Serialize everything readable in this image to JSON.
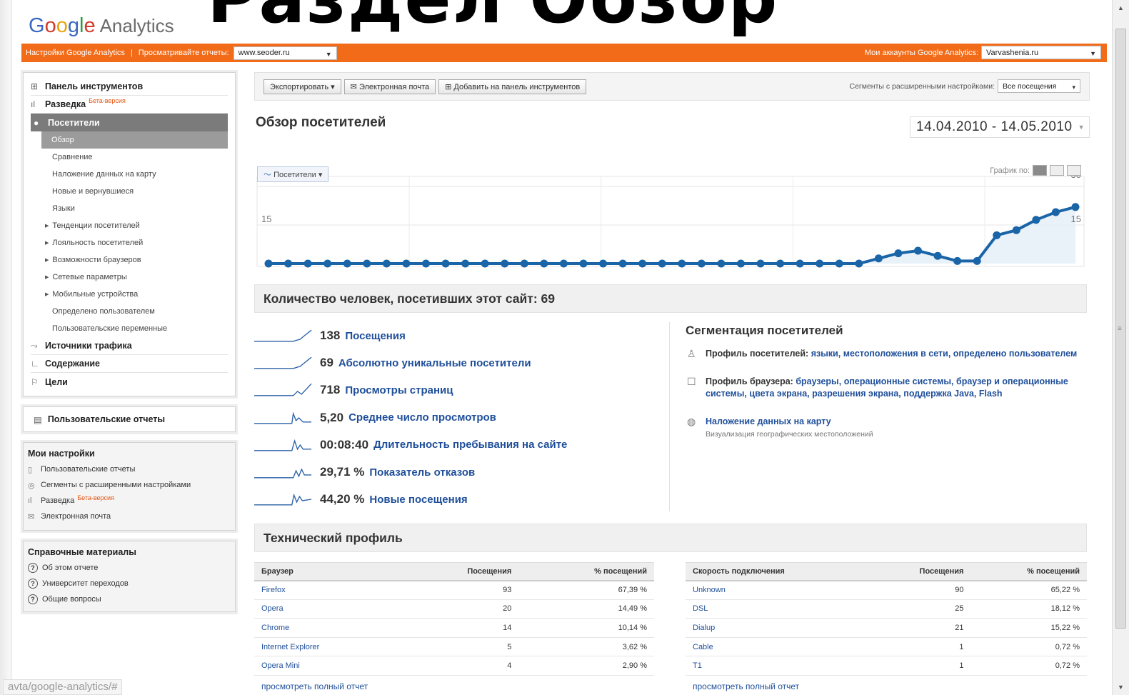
{
  "overlay": {
    "title": "Раздел Обзор"
  },
  "logo": {
    "g1": "G",
    "o1": "o",
    "o2": "o",
    "g2": "g",
    "l": "l",
    "e": "e",
    "analytics": "Analytics"
  },
  "topbar": {
    "settings_link": "Настройки Google Analytics",
    "sep": "|",
    "view_label": "Просматривайте отчеты:",
    "site_value": "www.seoder.ru",
    "accounts_label": "Мои аккаунты Google Analytics:",
    "account_value": "Varvashenia.ru"
  },
  "sidebar": {
    "top_items": [
      {
        "label": "Панель инструментов"
      },
      {
        "label": "Разведка",
        "badge": "Бета-версия"
      },
      {
        "label": "Посетители"
      }
    ],
    "visitors_sub": [
      "Обзор",
      "Сравнение",
      "Наложение данных на карту",
      "Новые и вернувшиеся",
      "Языки",
      "Тенденции посетителей",
      "Лояльность посетителей",
      "Возможности браузеров",
      "Сетевые параметры",
      "Мобильные устройства",
      "Определено пользователем",
      "Пользовательские переменные"
    ],
    "bottom_items": [
      {
        "label": "Источники трафика"
      },
      {
        "label": "Содержание"
      },
      {
        "label": "Цели"
      }
    ],
    "custom_reports": "Пользовательские отчеты",
    "my_settings": {
      "title": "Мои настройки",
      "items": [
        "Пользовательские отчеты",
        "Сегменты с расширенными настройками",
        "Разведка",
        "Электронная почта"
      ],
      "badge": "Бета-версия"
    },
    "help": {
      "title": "Справочные материалы",
      "items": [
        "Об этом отчете",
        "Университет переходов",
        "Общие вопросы"
      ]
    }
  },
  "toolbar": {
    "export": "Экспортировать",
    "email": "Электронная почта",
    "add_dashboard": "Добавить на панель инструментов",
    "segments_label": "Сегменты с расширенными настройками:",
    "segments_value": "Все посещения"
  },
  "page": {
    "title": "Обзор посетителей",
    "date_range": "14.04.2010 - 14.05.2010"
  },
  "chart": {
    "metric_selector": "Посетители",
    "graph_by_label": "График по:"
  },
  "chart_data": {
    "type": "line",
    "series": [
      {
        "name": "Посетители",
        "values": [
          0,
          0,
          0,
          0,
          0,
          0,
          0,
          0,
          0,
          0,
          0,
          0,
          0,
          0,
          0,
          0,
          0,
          0,
          0,
          0,
          0,
          0,
          0,
          0,
          0,
          0,
          0,
          0,
          0,
          0,
          0,
          2,
          4,
          5,
          3,
          1,
          1,
          11,
          13,
          17,
          20,
          22
        ]
      }
    ],
    "yticks": [
      "30",
      "15"
    ],
    "ylim": [
      0,
      30
    ],
    "color": "#1a64a8"
  },
  "visitors_summary": "Количество человек, посетивших этот сайт: 69",
  "metrics": [
    {
      "value": "138",
      "label": "Посещения"
    },
    {
      "value": "69",
      "label": "Абсолютно уникальные посетители"
    },
    {
      "value": "718",
      "label": "Просмотры страниц"
    },
    {
      "value": "5,20",
      "label": "Среднее число просмотров"
    },
    {
      "value": "00:08:40",
      "label": "Длительность пребывания на сайте"
    },
    {
      "value": "29,71 %",
      "label": "Показатель отказов"
    },
    {
      "value": "44,20 %",
      "label": "Новые посещения"
    }
  ],
  "segmentation": {
    "title": "Сегментация посетителей",
    "visitor_profile": {
      "label": "Профиль посетителей:",
      "l1": "языки,",
      "l2": "местоположения в сети,",
      "l3": "определено пользователем"
    },
    "browser_profile": {
      "label": "Профиль браузера:",
      "l1": "браузеры,",
      "l2": "операционные системы,",
      "l3": "браузер и операционные системы,",
      "l4": "цвета экрана,",
      "l5": "разрешения экрана,",
      "l6": "поддержка Java,",
      "l7": "Flash"
    },
    "map_overlay": {
      "label": "Наложение данных на карту",
      "desc": "Визуализация географических местоположений"
    }
  },
  "tech": {
    "title": "Технический профиль",
    "browser_table": {
      "headers": [
        "Браузер",
        "Посещения",
        "% посещений"
      ],
      "rows": [
        [
          "Firefox",
          "93",
          "67,39 %"
        ],
        [
          "Opera",
          "20",
          "14,49 %"
        ],
        [
          "Chrome",
          "14",
          "10,14 %"
        ],
        [
          "Internet Explorer",
          "5",
          "3,62 %"
        ],
        [
          "Opera Mini",
          "4",
          "2,90 %"
        ]
      ]
    },
    "connection_table": {
      "headers": [
        "Скорость подключения",
        "Посещения",
        "% посещений"
      ],
      "rows": [
        [
          "Unknown",
          "90",
          "65,22 %"
        ],
        [
          "DSL",
          "25",
          "18,12 %"
        ],
        [
          "Dialup",
          "21",
          "15,22 %"
        ],
        [
          "Cable",
          "1",
          "0,72 %"
        ],
        [
          "T1",
          "1",
          "0,72 %"
        ]
      ]
    },
    "full_report": "просмотреть полный отчет"
  },
  "status_url": "avta/google-analytics/#"
}
